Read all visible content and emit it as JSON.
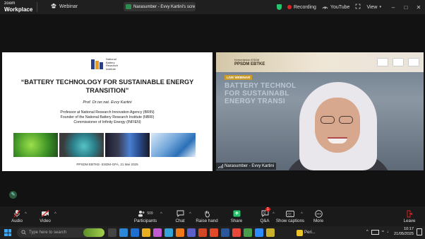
{
  "topbar": {
    "logo_line1": "zoom",
    "logo_line2": "Workplace",
    "webinar_label": "Webinar",
    "share_title": "Narasumber - Evvy Kartini's scre",
    "recording_label": "Recording",
    "youtube_label": "YouTube",
    "view_label": "View"
  },
  "slide": {
    "org_name": "National\nBattery\nResearch\nInstitute",
    "title_line1": "“BATTERY TECHNOLOGY FOR SUSTAINABLE ENERGY",
    "title_line2": "TRANSITION”",
    "author": "Prof. Dr.rer.nat. Evvy Kartini",
    "role1": "Professor at National Research Innovation Agency (BRIN)",
    "role2": "Founder of the National Battery Research Institute (NBRI)",
    "role3": "Commissioner of Infinity Energy (INFIEN)",
    "footer": "PPSDM EBTKE- ESDM-GFA, 21 Mei 2025"
  },
  "video": {
    "brand_small": "Kementerian ESDM",
    "brand": "PPSDM EBTKE",
    "live_badge": "LIVE WEBINAR",
    "bg_text_line1": "BATTERY TECHNOL",
    "bg_text_line2": "FOR SUSTAINABL",
    "bg_text_line3": "ENERGY TRANSI",
    "participant_name": "Narasumber - Evvy Kartini"
  },
  "toolbar": {
    "audio": "Audio",
    "video": "Video",
    "participants": "Participants",
    "participants_count": "509",
    "chat": "Chat",
    "raise_hand": "Raise hand",
    "share": "Share",
    "qa": "Q&A",
    "qa_badge": "1",
    "show_captions": "Show captions",
    "more": "More",
    "leave": "Leave"
  },
  "taskbar": {
    "search_placeholder": "Type here to search",
    "active_app": "Peri...",
    "time": "10:17",
    "date": "21/05/2025"
  },
  "colors": {
    "recording": "#e02424",
    "share_green": "#27c26e",
    "leave_red": "#e02424"
  }
}
